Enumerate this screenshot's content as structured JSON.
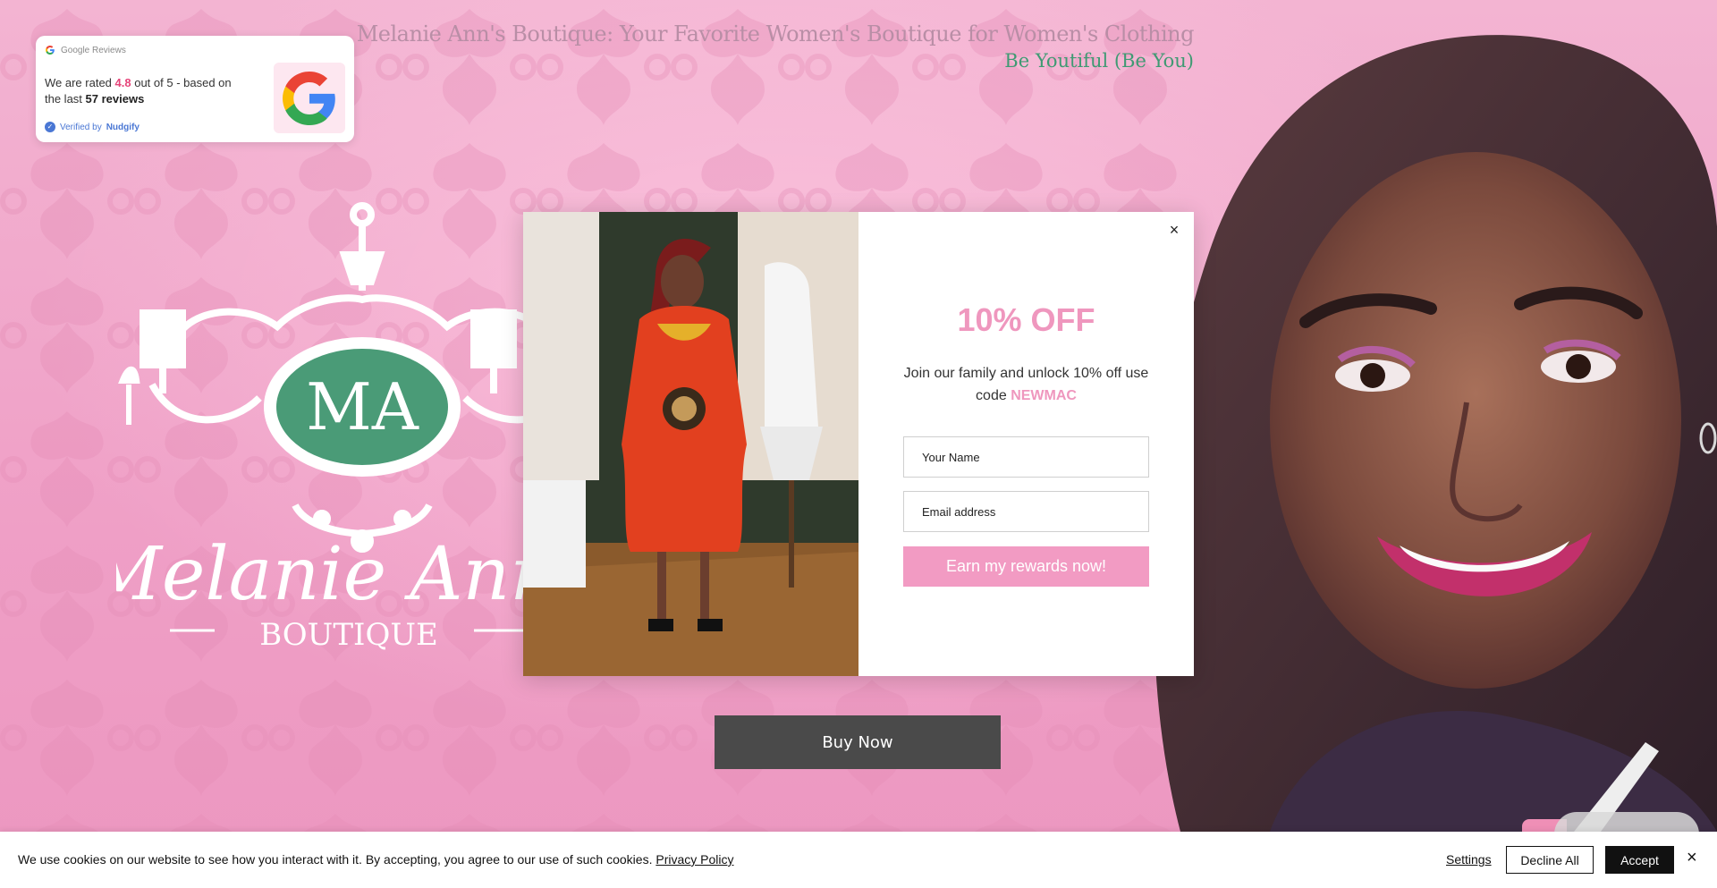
{
  "header": {
    "title": "Melanie Ann's Boutique: Your Favorite Women's Boutique for Women's Clothing",
    "tagline": "Be Youtiful (Be You)"
  },
  "reviews_badge": {
    "source": "Google Reviews",
    "text_prefix": "We are rated ",
    "rating": "4.8",
    "text_mid": " out of 5 - based on the last ",
    "count": "57 reviews",
    "verified_prefix": "Verified by ",
    "verified_brand": "Nudgify",
    "icon": "google-icon"
  },
  "logo": {
    "monogram": "MA",
    "name": "Melanie Ann",
    "subtitle": "BOUTIQUE"
  },
  "buy_button": {
    "label": "Buy Now"
  },
  "popup": {
    "title": "10% OFF",
    "description_prefix": "Join our family and unlock 10% off use code ",
    "code": "NEWMAC",
    "name_placeholder": "Your Name",
    "email_placeholder": "Email address",
    "submit_label": "Earn my rewards now!",
    "close_label": "×"
  },
  "cookie_bar": {
    "text": "We use cookies on our website to see how you interact with it. By accepting, you agree to our use of such cookies.",
    "privacy_link": "Privacy Policy",
    "settings_label": "Settings",
    "decline_label": "Decline All",
    "accept_label": "Accept",
    "close_label": "×"
  },
  "colors": {
    "background_pink": "#f2a9cc",
    "accent_pink": "#ef97be",
    "brand_green": "#3f9a73",
    "dark_button": "#4a4a4a"
  }
}
